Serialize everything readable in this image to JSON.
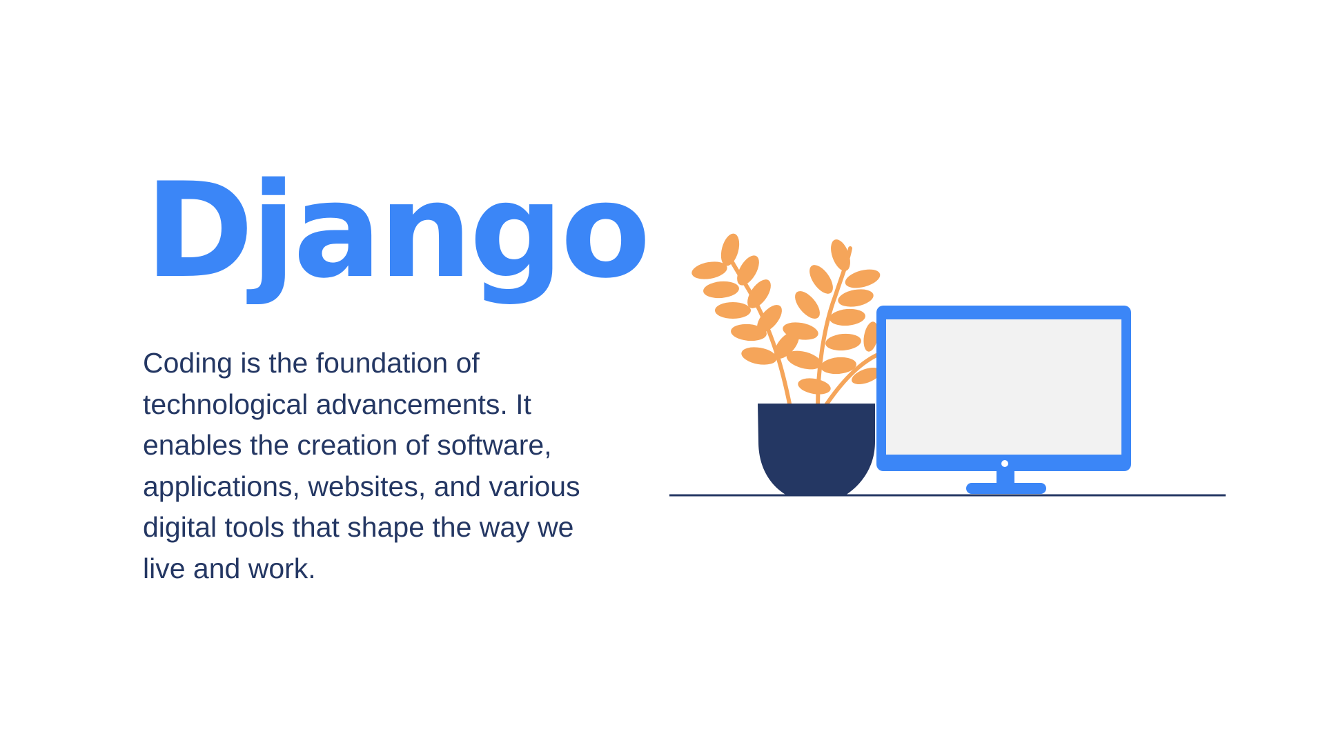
{
  "slide": {
    "title": "Django",
    "body": " Coding is the foundation of\ntechnological advancements. It\nenables the creation of software,\napplications, websites, and various\ndigital tools that shape the way we\nlive and work."
  },
  "colors": {
    "title": "#3b86f7",
    "body_text": "#243763",
    "monitor": "#3b86f7",
    "screen": "#f2f2f2",
    "pot": "#243763",
    "leaves": "#f5a55a",
    "floor_line": "#243763",
    "background": "#ffffff"
  },
  "illustration": {
    "icons": [
      "potted-plant-icon",
      "desktop-monitor-icon"
    ]
  }
}
